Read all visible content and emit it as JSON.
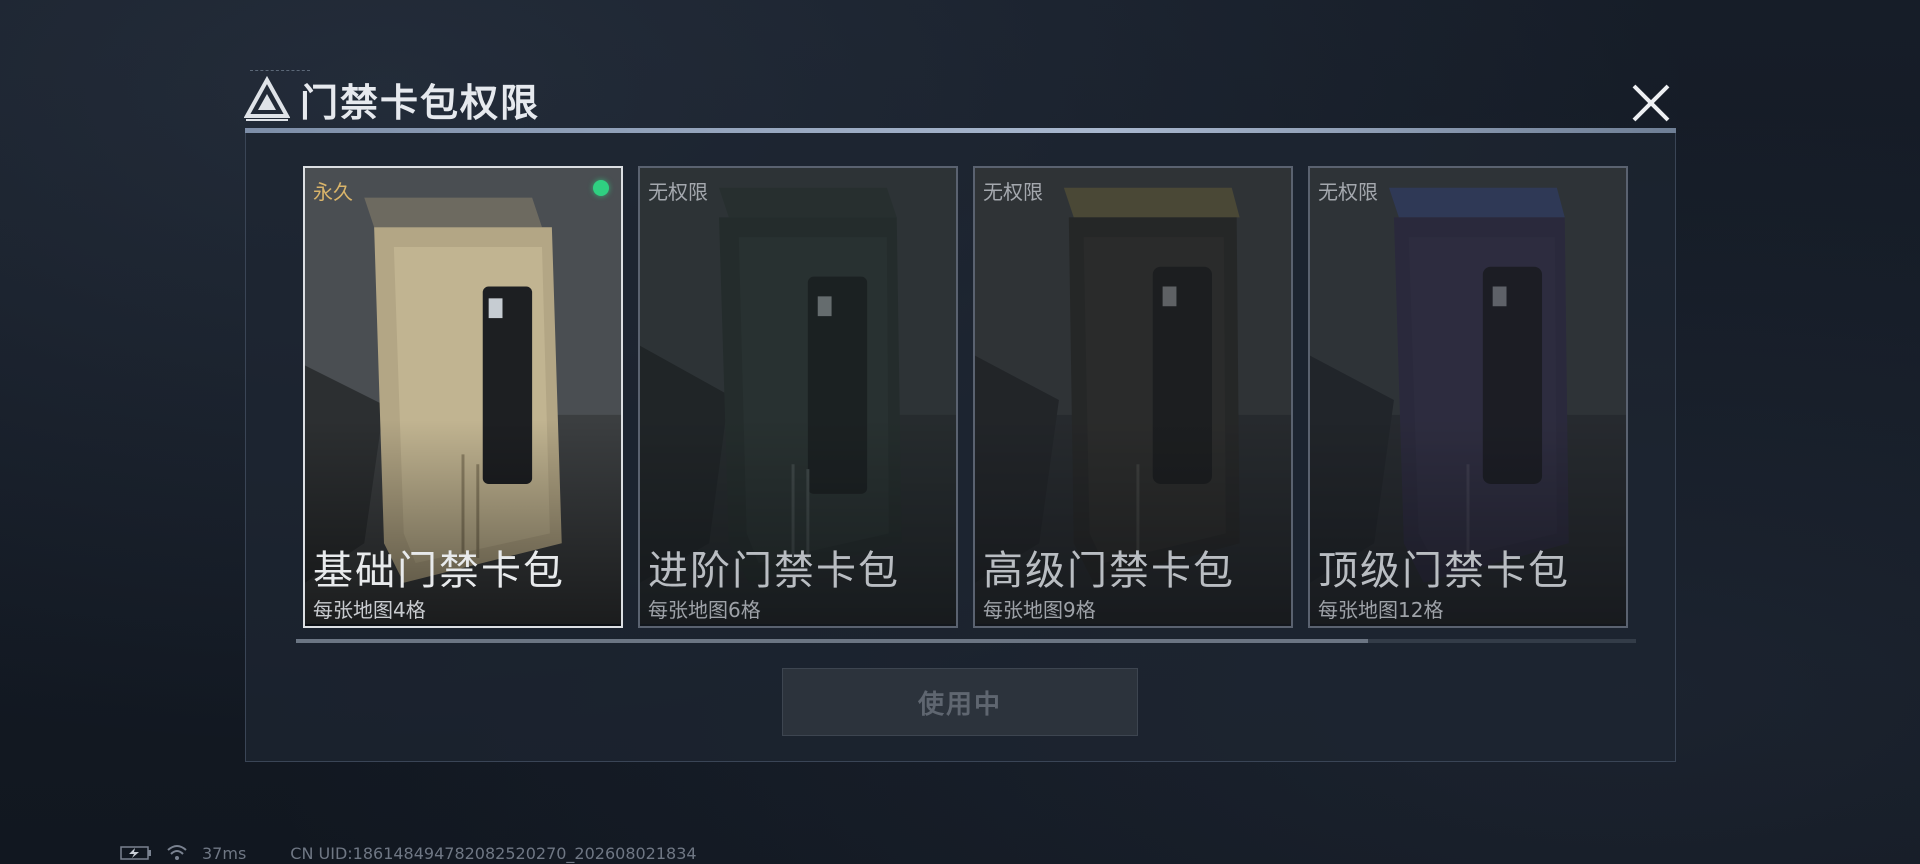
{
  "dialog": {
    "title": "门禁卡包权限",
    "icon": "triangle-logo-icon",
    "close_icon": "close-icon"
  },
  "cards": [
    {
      "status": "永久",
      "name": "基础门禁卡包",
      "capacity": "每张地图4格",
      "selected": true,
      "in_use": true,
      "accent": "#b8a988"
    },
    {
      "status": "无权限",
      "name": "进阶门禁卡包",
      "capacity": "每张地图6格",
      "selected": false,
      "in_use": false,
      "accent": "#2e3b34"
    },
    {
      "status": "无权限",
      "name": "高级门禁卡包",
      "capacity": "每张地图9格",
      "selected": false,
      "in_use": false,
      "accent": "#3a3628"
    },
    {
      "status": "无权限",
      "name": "顶级门禁卡包",
      "capacity": "每张地图12格",
      "selected": false,
      "in_use": false,
      "accent": "#3a3446"
    }
  ],
  "scroll": {
    "position_fraction": 0.8
  },
  "action_button": {
    "label": "使用中",
    "enabled": false
  },
  "footer": {
    "ping": "37ms",
    "uid": "CN UID:18614849478208252027​0_202608021834",
    "battery_icon": "battery-charging-icon",
    "wifi_icon": "wifi-icon"
  },
  "colors": {
    "selected_status": "#d9b46a",
    "in_use_dot": "#2fd081",
    "panel_accent": "#a9b8cf"
  }
}
